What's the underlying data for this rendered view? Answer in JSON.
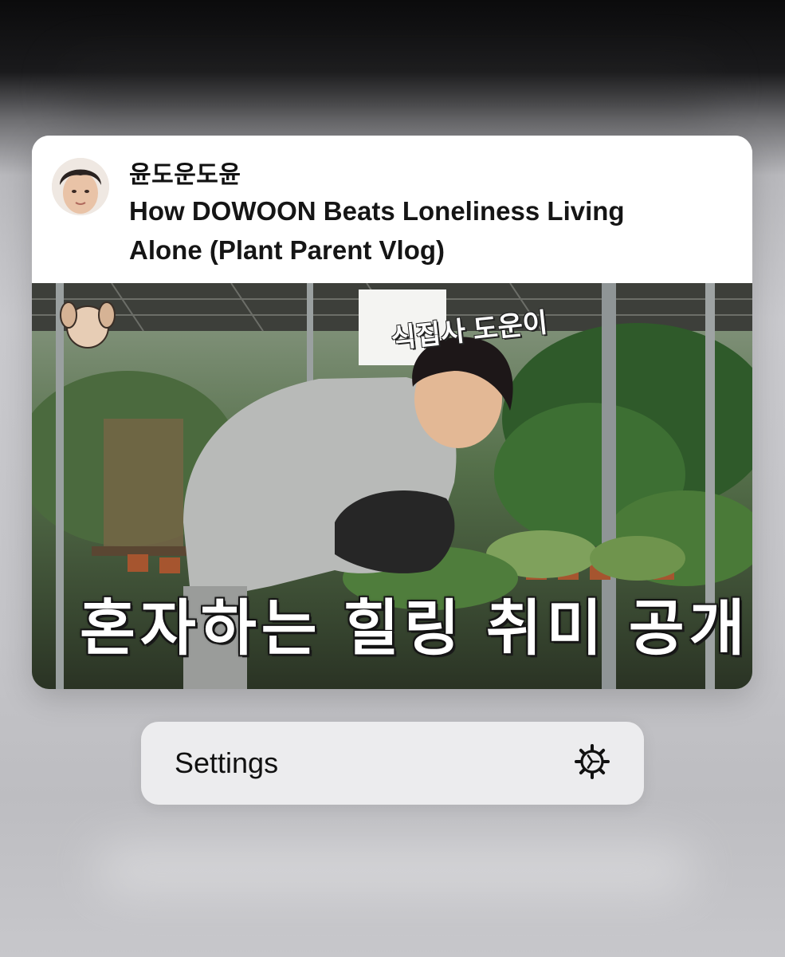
{
  "preview": {
    "channel_name": "윤도운도윤",
    "video_title": "How DOWOON Beats Loneliness Living Alone (Plant Parent Vlog)",
    "thumbnail": {
      "caption": "혼자하는 힐링 취미 공개",
      "sticker": "식집사 도운이"
    }
  },
  "menu": {
    "settings_label": "Settings",
    "settings_icon": "gear-icon"
  },
  "colors": {
    "card_background": "#ffffff",
    "menu_background": "#ececee"
  }
}
